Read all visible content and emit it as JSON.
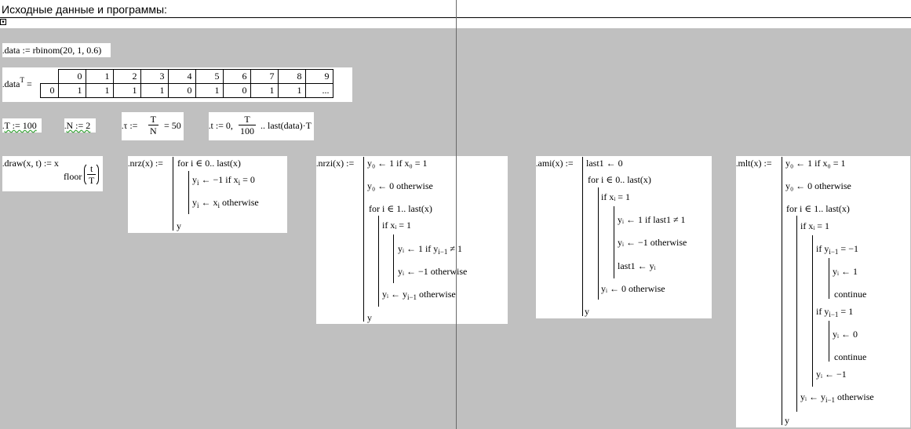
{
  "region": {
    "title": "Исходные данные и программы:"
  },
  "data_def": {
    "lhs": "data",
    "assign": " := ",
    "rhs": "rbinom(20, 1, 0.6)"
  },
  "matrix": {
    "lhs": "data",
    "sup": "T",
    "eq": " =",
    "col_headers": [
      "0",
      "1",
      "2",
      "3",
      "4",
      "5",
      "6",
      "7",
      "8",
      "9"
    ],
    "row_header": "0",
    "values": [
      "1",
      "1",
      "1",
      "1",
      "0",
      "1",
      "0",
      "1",
      "1",
      "..."
    ]
  },
  "defs": {
    "T": "T := 100",
    "N": "N := 2",
    "tau_lhs": "τ :=",
    "tau_num": "T",
    "tau_den": "N",
    "tau_val": "= 50",
    "t_lhs": "t := 0,",
    "t_num": "T",
    "t_den": "100",
    "t_rest": ".. last(data)·T"
  },
  "draw": {
    "lhs": "draw(x, t) := x",
    "floor": "floor",
    "num": "t",
    "den": "T"
  },
  "nrz": {
    "lhs": "nrz(x) :=",
    "l1": "for  i ∈ 0.. last(x)",
    "l2a": "y",
    "l2b": " ← −1  if  x",
    "l2c": " = 0",
    "l3a": "y",
    "l3b": " ← x",
    "l3c": "  otherwise",
    "ret": "y"
  },
  "nrzi": {
    "lhs": "nrzi(x) :=",
    "l1": "y₀ ← 1  if  x₀ = 1",
    "l2": "y₀ ← 0  otherwise",
    "l3": "for  i ∈ 1.. last(x)",
    "l4": "if  xᵢ = 1",
    "l5a": "yᵢ ← 1  if  y",
    "l5b": "i−1",
    "l5c": " ≠ 1",
    "l6": "yᵢ ← −1  otherwise",
    "l7a": "yᵢ ← y",
    "l7b": "i−1",
    "l7c": "  otherwise",
    "ret": "y"
  },
  "ami": {
    "lhs": "ami(x) :=",
    "l1": "last1 ← 0",
    "l2": "for  i ∈ 0.. last(x)",
    "l3": "if  xᵢ = 1",
    "l4": "yᵢ ← 1  if  last1 ≠ 1",
    "l5": "yᵢ ← −1  otherwise",
    "l6": "last1 ← yᵢ",
    "l7": "yᵢ ← 0  otherwise",
    "ret": "y"
  },
  "mlt": {
    "lhs": "mlt(x) :=",
    "l1": "y₀ ← 1  if  x₀ = 1",
    "l2": "y₀ ← 0  otherwise",
    "l3": "for  i ∈ 1.. last(x)",
    "l4": "if  xᵢ = 1",
    "l5a": "if  y",
    "l5b": "i−1",
    "l5c": " = −1",
    "l6": "yᵢ ← 1",
    "l7": "continue",
    "l8a": "if  y",
    "l8b": "i−1",
    "l8c": " = 1",
    "l9": "yᵢ ← 0",
    "l10": "continue",
    "l11": "yᵢ ← −1",
    "l12a": "yᵢ ← y",
    "l12b": "i−1",
    "l12c": "  otherwise",
    "ret": "y"
  }
}
